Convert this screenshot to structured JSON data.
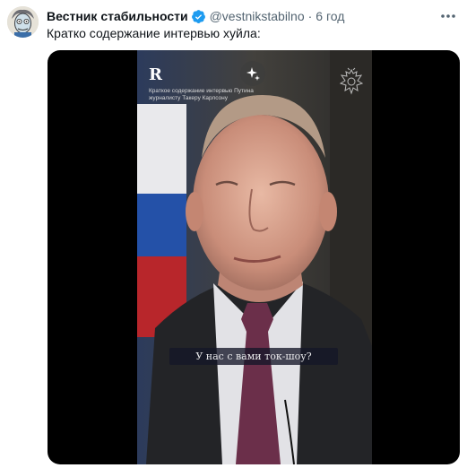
{
  "tweet": {
    "author_name": "Вестник стабильности",
    "handle": "@vestnikstabilno",
    "separator": "·",
    "time": "6 год",
    "text": "Кратко содержание интервью хуйла:"
  },
  "video": {
    "overlay_title": "Краткое содержание интервью Путина журналисту Такеру Карлсону",
    "subtitle": "У нас с вами ток-шоу?"
  },
  "colors": {
    "verified": "#1d9bf0",
    "handle_gray": "#536471"
  }
}
